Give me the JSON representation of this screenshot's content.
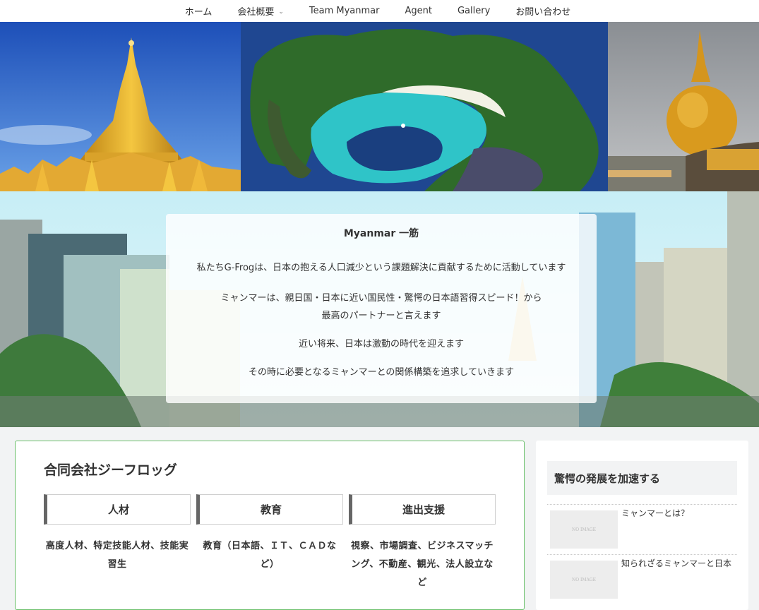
{
  "nav": {
    "items": [
      {
        "label": "ホーム"
      },
      {
        "label": "会社概要",
        "has_dropdown": true
      },
      {
        "label": "Team Myanmar"
      },
      {
        "label": "Agent"
      },
      {
        "label": "Gallery"
      },
      {
        "label": "お問い合わせ"
      }
    ]
  },
  "mission": {
    "title": "Myanmar 一筋",
    "lines": [
      "私たちG-Frogは、日本の抱える人口減少という課題解決に貢献するために活動しています",
      "ミャンマーは、親日国・日本に近い国民性・驚愕の日本語習得スピード！から",
      "最高のパートナーと言えます",
      "近い将来、日本は激動の時代を迎えます",
      "その時に必要となるミャンマーとの関係構築を追求していきます"
    ]
  },
  "main": {
    "company_name": "合同会社ジーフロッグ",
    "services": [
      {
        "title": "人材",
        "description": "高度人材、特定技能人材、技能実習生"
      },
      {
        "title": "教育",
        "description": "教育（日本語、ＩＴ、ＣＡＤなど）"
      },
      {
        "title": "進出支援",
        "description": "視察、市場調査、ビジネスマッチング、不動産、観光、法人設立など"
      }
    ]
  },
  "sidebar": {
    "heading": "驚愕の発展を加速する",
    "posts": [
      {
        "title": "ミャンマーとは？",
        "thumb_text": "NO IMAGE"
      },
      {
        "title": "知られざるミャンマーと日本",
        "thumb_text": "NO IMAGE"
      }
    ]
  },
  "colors": {
    "card_border": "#6ac06a",
    "service_accent": "#666666",
    "page_background": "#f2f3f4"
  }
}
